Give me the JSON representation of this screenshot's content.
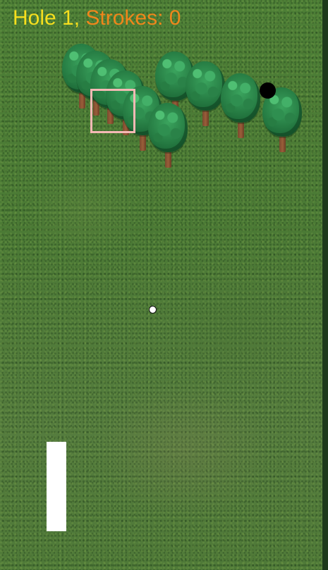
{
  "hud": {
    "hole_text": "Hole 1,",
    "strokes_text": "Strokes: 0",
    "hole_color": "#f7df1e",
    "strokes_color": "#f0861b"
  },
  "game": {
    "hole_number": 1,
    "strokes": 0,
    "power_fraction": 1.0,
    "colors": {
      "grass": "#4b7a35",
      "cup": "#000000",
      "ball": "#ffffff",
      "aim_box": "#f4b9b5",
      "power_bar": "#ffffff"
    }
  }
}
